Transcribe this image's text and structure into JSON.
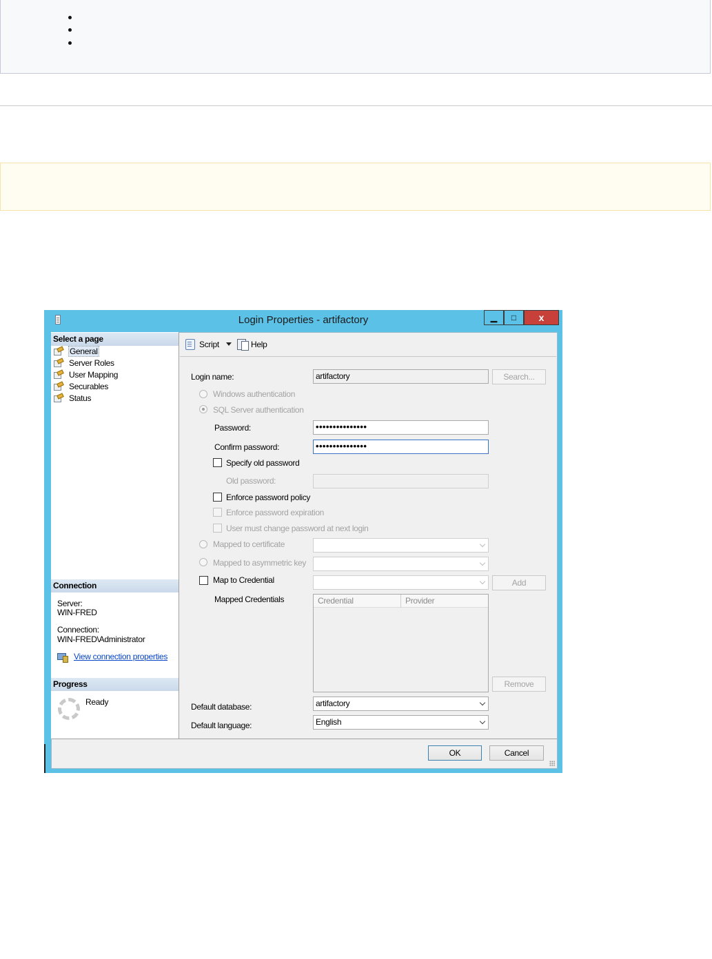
{
  "dialog": {
    "title": "Login Properties - artifactory",
    "window_buttons": {
      "minimize": "▁",
      "maximize": "□",
      "close": "x"
    }
  },
  "left_pane": {
    "select_page_header": "Select a page",
    "pages": [
      {
        "label": "General",
        "selected": true
      },
      {
        "label": "Server Roles"
      },
      {
        "label": "User Mapping"
      },
      {
        "label": "Securables"
      },
      {
        "label": "Status"
      }
    ],
    "connection": {
      "header": "Connection",
      "server_label": "Server:",
      "server_value": "WIN-FRED",
      "connection_label": "Connection:",
      "connection_value": "WIN-FRED\\Administrator",
      "link": "View connection properties"
    },
    "progress": {
      "header": "Progress",
      "status": "Ready"
    }
  },
  "toolbar": {
    "script": "Script",
    "help": "Help"
  },
  "form": {
    "login_name_label": "Login name:",
    "login_name_value": "artifactory",
    "search_button": "Search...",
    "windows_auth": "Windows authentication",
    "sql_auth": "SQL Server authentication",
    "password_label": "Password:",
    "password_value": "•••••••••••••••",
    "confirm_label": "Confirm password:",
    "confirm_value": "•••••••••••••••",
    "specify_old": "Specify old password",
    "old_password_label": "Old password:",
    "enforce_policy": "Enforce password policy",
    "enforce_expiration": "Enforce password expiration",
    "must_change": "User must change password at next login",
    "mapped_cert": "Mapped to certificate",
    "mapped_asym": "Mapped to asymmetric key",
    "map_credential": "Map to Credential",
    "add_button": "Add",
    "mapped_credentials_label": "Mapped Credentials",
    "grid_columns": [
      "Credential",
      "Provider"
    ],
    "remove_button": "Remove",
    "default_db_label": "Default database:",
    "default_db_value": "artifactory",
    "default_lang_label": "Default language:",
    "default_lang_value": "English"
  },
  "footer": {
    "ok": "OK",
    "cancel": "Cancel"
  }
}
